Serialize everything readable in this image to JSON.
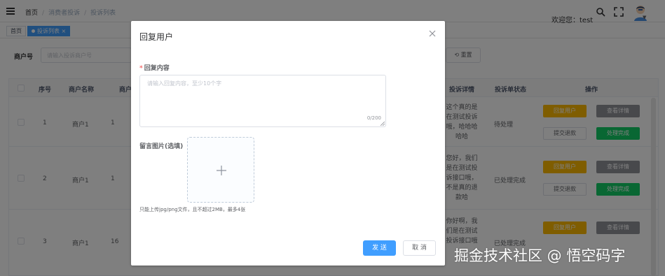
{
  "header": {
    "breadcrumbs": [
      "首页",
      "消费者投诉",
      "投诉列表"
    ],
    "welcome": "欢迎您：test"
  },
  "tags": [
    {
      "label": "首页"
    },
    {
      "label": "投诉列表"
    }
  ],
  "filter": {
    "merchant_label": "商户号",
    "merchant_placeholder": "请输入投诉商户号",
    "reset_label": "重置"
  },
  "table": {
    "columns": [
      "序号",
      "商户名称",
      "商户",
      "投诉详情",
      "投诉单状态",
      "操作"
    ],
    "rows": [
      {
        "index": "1",
        "merchant": "商户1",
        "merchant_no": "1",
        "detail": "这个真的是在测试投诉哦，哈哈哈哈哈",
        "status": "待处理"
      },
      {
        "index": "2",
        "merchant": "商户1",
        "merchant_no": "1",
        "detail": "您好，我们是在测试投诉接口哦，不是真的退款哈",
        "status": "已处理完成"
      },
      {
        "index": "3",
        "merchant": "商户1",
        "merchant_no": "16",
        "detail": "你好啊，我们是在测试投诉接口哦",
        "status": "已处理完成"
      }
    ],
    "actions": {
      "reply": "回复用户",
      "view": "查看详情",
      "refund": "提交退款",
      "complete": "处理完成"
    }
  },
  "dialog": {
    "title": "回复用户",
    "content_label": "回复内容",
    "content_placeholder": "请输入回复内容，至少10个字",
    "counter": "0/200",
    "image_label": "留言图片(选填)",
    "upload_hint": "只能上传jpg/png文件，且不超过2MB，最多4张",
    "send_label": "发 送",
    "cancel_label": "取 消"
  },
  "watermark": "掘金技术社区 @ 悟空码字",
  "colors": {
    "primary": "#409eff",
    "warning": "#ffba00",
    "info": "#909399",
    "success": "#13ce66",
    "danger": "#f56c6c"
  }
}
